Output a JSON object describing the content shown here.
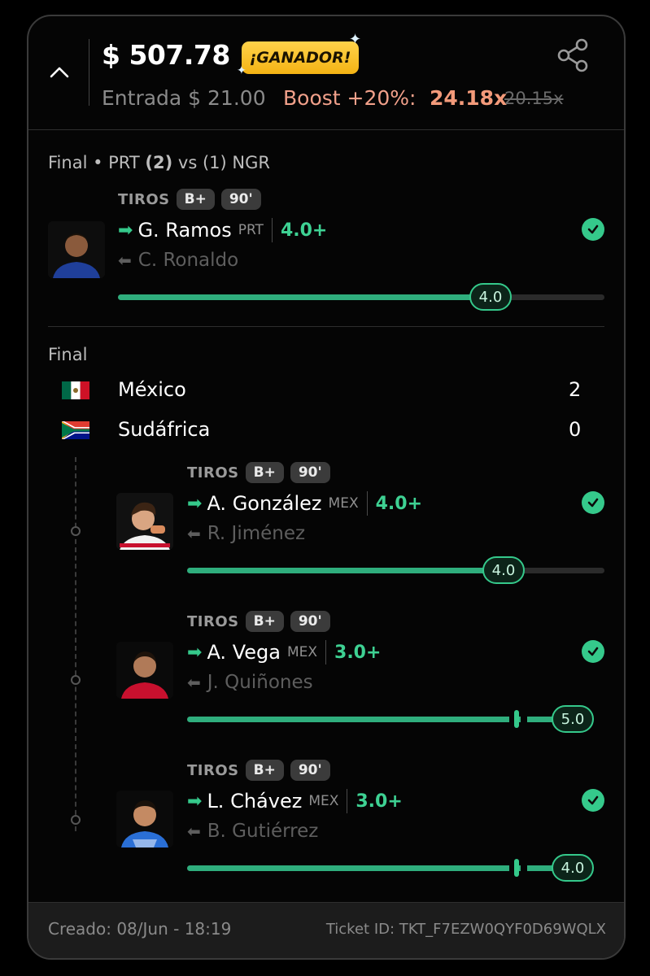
{
  "header": {
    "payout": "$ 507.78",
    "badge": "¡GANADOR!",
    "entry": "Entrada $ 21.00",
    "boost_label": "Boost +20%:",
    "boost_value": "24.18x",
    "boost_old": "20.15x"
  },
  "colors": {
    "accent": "#35c98b",
    "badge": "#f4b314",
    "boost": "#f39a7a"
  },
  "section1": {
    "title_prefix": "Final • PRT",
    "home_score": "(2)",
    "vs": "vs",
    "away_score": "(1)",
    "away": "NGR",
    "pick": {
      "stat": "TIROS",
      "tier": "B+",
      "minutes": "90'",
      "player": "G. Ramos",
      "team": "PRT",
      "line": "4.0+",
      "alt": "C. Ronaldo",
      "result": "4.0",
      "progress": 0.77
    }
  },
  "section2": {
    "title": "Final",
    "teams": [
      {
        "name": "México",
        "score": "2"
      },
      {
        "name": "Sudáfrica",
        "score": "0"
      }
    ],
    "picks": [
      {
        "stat": "TIROS",
        "tier": "B+",
        "minutes": "90'",
        "player": "A. González",
        "team": "MEX",
        "line": "4.0+",
        "alt": "R. Jiménez",
        "result": "4.0"
      },
      {
        "stat": "TIROS",
        "tier": "B+",
        "minutes": "90'",
        "player": "A. Vega",
        "team": "MEX",
        "line": "3.0+",
        "alt": "J. Quiñones",
        "result": "5.0"
      },
      {
        "stat": "TIROS",
        "tier": "B+",
        "minutes": "90'",
        "player": "L. Chávez",
        "team": "MEX",
        "line": "3.0+",
        "alt": "B. Gutiérrez",
        "result": "4.0"
      }
    ]
  },
  "footer": {
    "created": "Creado: 08/Jun - 18:19",
    "ticket": "Ticket ID: TKT_F7EZW0QYF0D69WQLX"
  }
}
